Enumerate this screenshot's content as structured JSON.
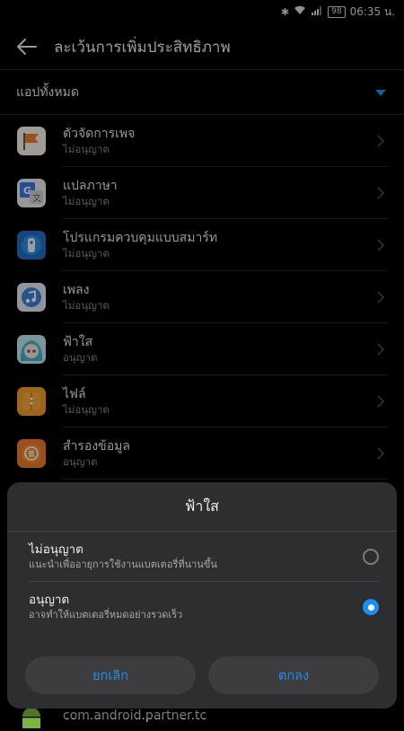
{
  "status_bar": {
    "battery": "98",
    "time": "06:35 น."
  },
  "header": {
    "title": "ละเว้นการเพิ่มประสิทธิภาพ"
  },
  "filter": {
    "label": "แอปทั้งหมด"
  },
  "apps": [
    {
      "name": "ตัวจัดการเพจ",
      "status": "ไม่อนุญาต",
      "icon": "page-manager-icon"
    },
    {
      "name": "แปลภาษา",
      "status": "ไม่อนุญาต",
      "icon": "translate-icon"
    },
    {
      "name": "โปรแกรมควบคุมแบบสมาร์ท",
      "status": "ไม่อนุญาต",
      "icon": "smart-remote-icon"
    },
    {
      "name": "เพลง",
      "status": "ไม่อนุญาต",
      "icon": "music-icon"
    },
    {
      "name": "ฟ้าใส",
      "status": "อนุญาต",
      "icon": "anime-character-icon"
    },
    {
      "name": "ไฟล์",
      "status": "ไม่อนุญาต",
      "icon": "files-icon"
    },
    {
      "name": "สำรองข้อมูล",
      "status": "อนุญาต",
      "icon": "backup-icon"
    }
  ],
  "bottom_app": {
    "name": "com.android.partner.tc",
    "icon": "android-icon"
  },
  "dialog": {
    "title": "ฟ้าใส",
    "options": [
      {
        "title": "ไม่อนุญาต",
        "subtitle": "แนะนำเพื่ออายุการใช้งานแบตเตอรี่ที่นานขึ้น",
        "selected": false
      },
      {
        "title": "อนุญาต",
        "subtitle": "อาจทำให้แบตเตอรี่หมดอย่างรวดเร็ว",
        "selected": true
      }
    ],
    "cancel_label": "ยกเลิก",
    "ok_label": "ตกลง"
  },
  "colors": {
    "accent": "#1e8ef2",
    "background": "#000000",
    "dialog": "#2e2e30"
  }
}
